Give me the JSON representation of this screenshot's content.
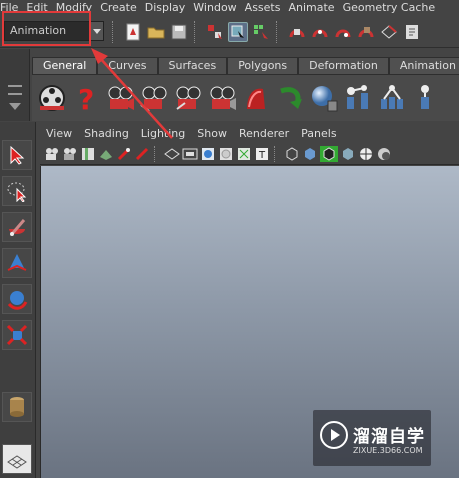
{
  "menubar": {
    "items": [
      "File",
      "Edit",
      "Modify",
      "Create",
      "Display",
      "Window",
      "Assets",
      "Animate",
      "Geometry Cache"
    ]
  },
  "statusline": {
    "mode_selector_value": "Animation"
  },
  "shelf": {
    "tabs": [
      "General",
      "Curves",
      "Surfaces",
      "Polygons",
      "Deformation",
      "Animation"
    ],
    "active_tab": "General"
  },
  "panel": {
    "menus": [
      "View",
      "Shading",
      "Lighting",
      "Show",
      "Renderer",
      "Panels"
    ]
  },
  "watermark": {
    "brand": "溜溜自学",
    "url": "ZIXUE.3D66.COM"
  },
  "colors": {
    "highlight": "#e23a3a",
    "annotation_arrow": "#e23a3a"
  }
}
